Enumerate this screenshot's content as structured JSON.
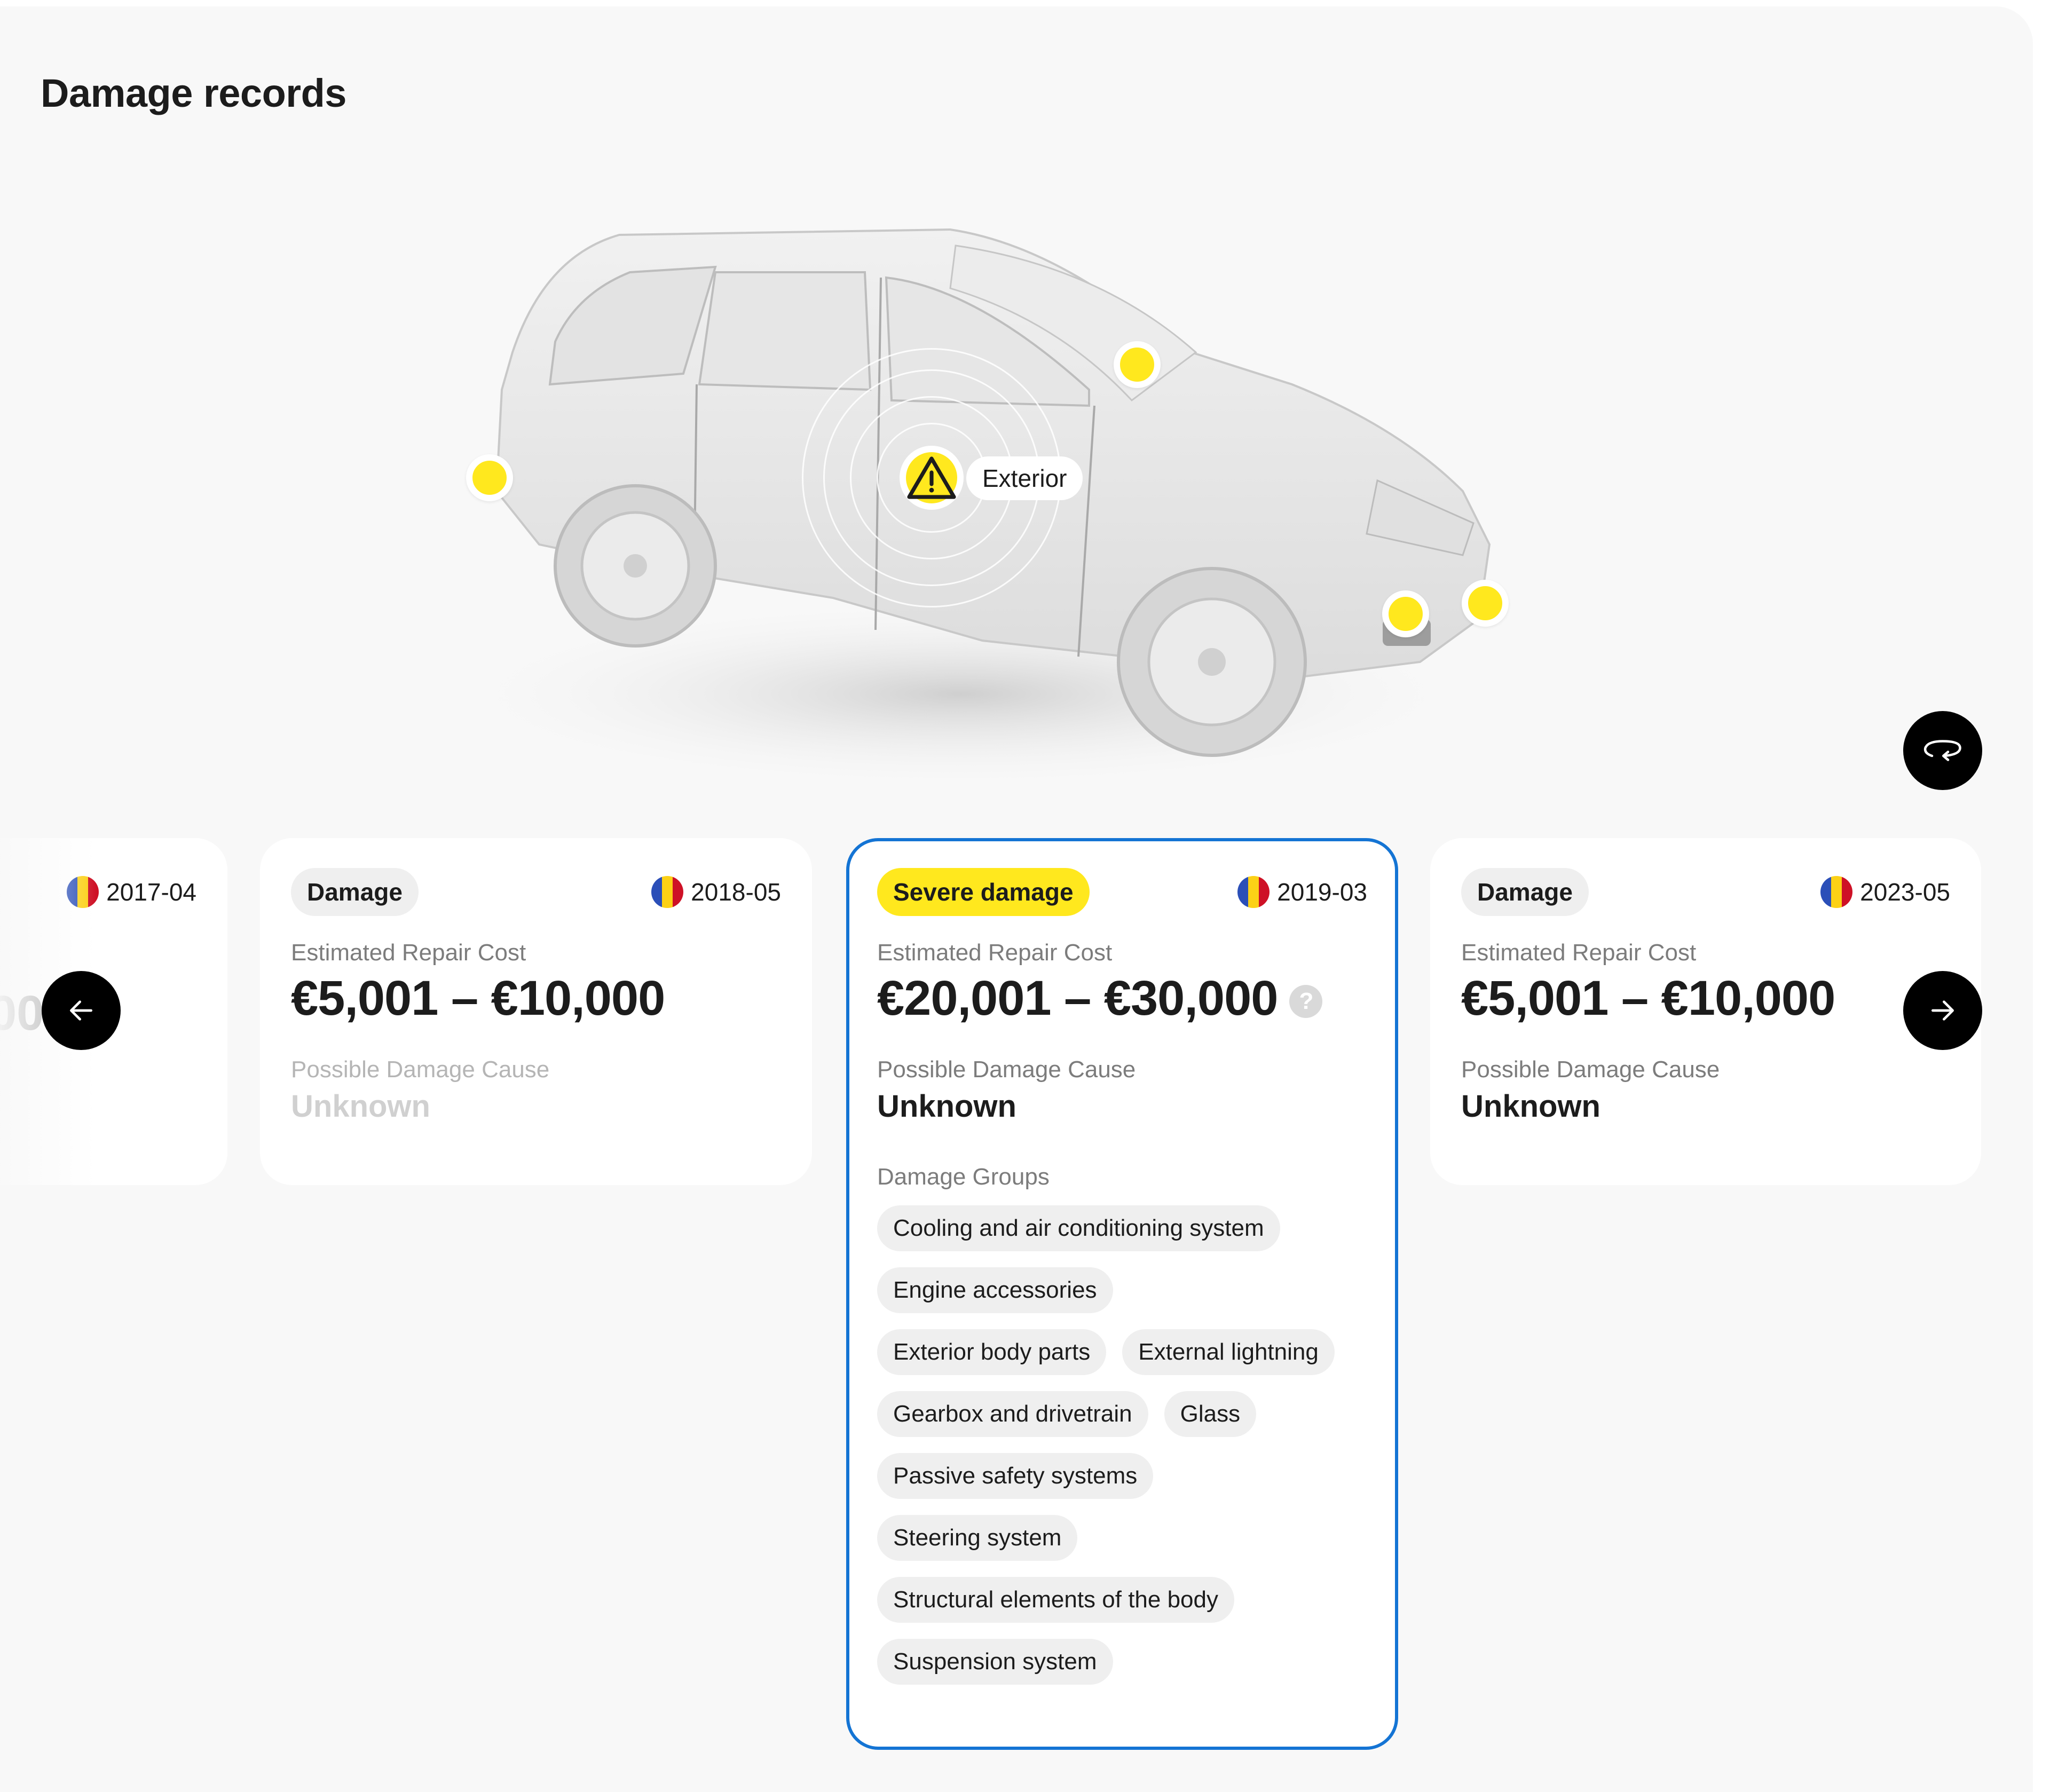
{
  "header": {
    "title": "Damage records"
  },
  "scene": {
    "active_hotspot": {
      "label": "Exterior",
      "icon": "warning-triangle-icon"
    },
    "hotspot_count": 5,
    "rotate_button": {
      "icon": "rotate-360-icon"
    },
    "accent_color": "#ffe81e"
  },
  "navigation": {
    "prev_icon": "arrow-left-icon",
    "next_icon": "arrow-right-icon"
  },
  "cards": [
    {
      "badge": "",
      "date": "2017-04",
      "country_flag": "Romania",
      "cost_partial": "00"
    },
    {
      "badge": "Damage",
      "severity": "normal",
      "date": "2018-05",
      "country_flag": "Romania",
      "cost_label": "Estimated Repair Cost",
      "cost": "€5,001 – €10,000",
      "cause_label": "Possible Damage Cause",
      "cause": "Unknown"
    },
    {
      "badge": "Severe damage",
      "severity": "severe",
      "selected": true,
      "date": "2019-03",
      "country_flag": "Romania",
      "cost_label": "Estimated Repair Cost",
      "cost": "€20,001 – €30,000",
      "cost_help_icon": "question-mark-icon",
      "cause_label": "Possible Damage Cause",
      "cause": "Unknown",
      "groups_label": "Damage Groups",
      "groups": [
        "Cooling and air conditioning system",
        "Engine accessories",
        "Exterior body parts",
        "External lightning",
        "Gearbox and drivetrain",
        "Glass",
        "Passive safety systems",
        "Steering system",
        "Structural elements of the body",
        "Suspension system"
      ]
    },
    {
      "badge": "Damage",
      "severity": "normal",
      "date": "2023-05",
      "country_flag": "Romania",
      "cost_label": "Estimated Repair Cost",
      "cost": "€5,001 – €10,000",
      "cause_label": "Possible Damage Cause",
      "cause": "Unknown"
    }
  ],
  "colors": {
    "selected_border": "#1474d4",
    "severe_badge": "#ffe81e",
    "badge_bg": "#efefef",
    "flag_blue": "#2b4fb8",
    "flag_yellow": "#fcd116",
    "flag_red": "#ce1126"
  }
}
